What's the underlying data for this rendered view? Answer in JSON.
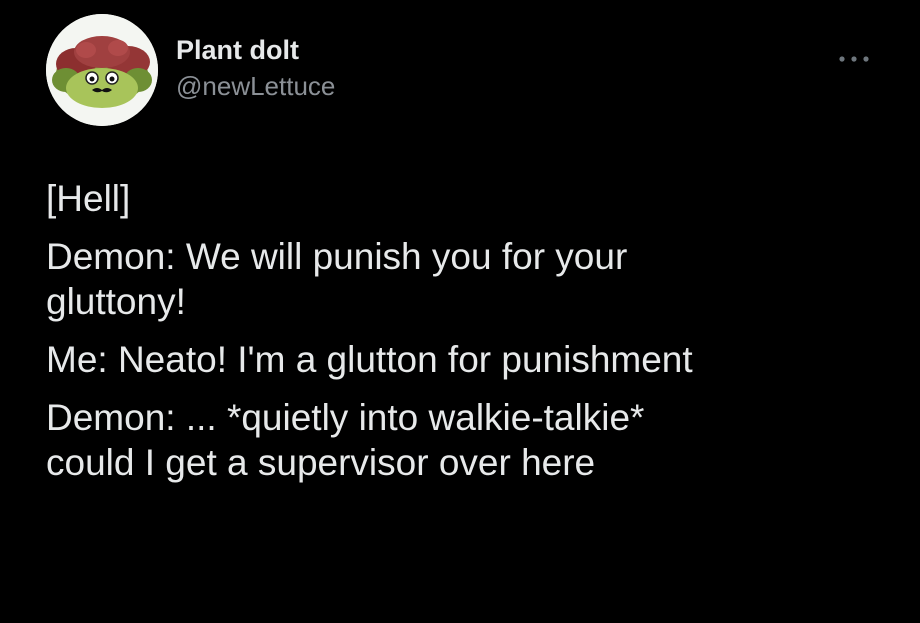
{
  "tweet": {
    "author": {
      "display_name": "Plant dolt",
      "handle": "@newLettuce",
      "avatar_icon": "lettuce-mascot-avatar"
    },
    "more_icon": "ellipsis-icon",
    "lines": [
      "[Hell]",
      "Demon: We will punish you for your",
      "gluttony!",
      "Me: Neato! I'm a glutton for punishment",
      "Demon: ... *quietly into walkie-talkie*",
      "could I get a supervisor over here"
    ]
  },
  "colors": {
    "background": "#000000",
    "text_primary": "#e7e9ea",
    "text_secondary": "#8b9096"
  }
}
